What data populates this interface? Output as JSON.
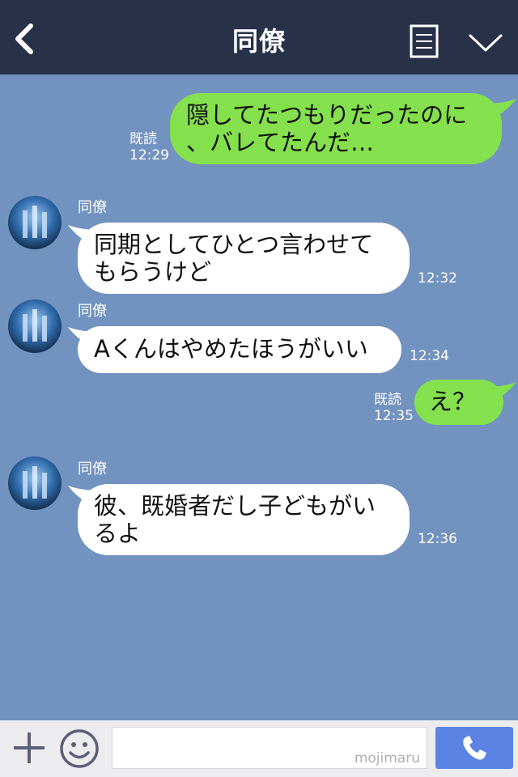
{
  "header": {
    "title": "同僚",
    "back_icon": "chevron-left-icon",
    "memo_icon": "memo-icon",
    "menu_icon": "chevron-down-icon"
  },
  "messages": [
    {
      "side": "me",
      "text": "隠してたつもりだったのに\n、バレてたんだ…",
      "read": "既読",
      "time": "12:29"
    },
    {
      "side": "them",
      "sender": "同僚",
      "text": "同期としてひとつ言わせて\nもらうけど",
      "time": "12:32"
    },
    {
      "side": "them",
      "sender": "同僚",
      "text": "Aくんはやめたほうがいい",
      "time": "12:34"
    },
    {
      "side": "me",
      "text": "え？",
      "read": "既読",
      "time": "12:35"
    },
    {
      "side": "them",
      "sender": "同僚",
      "text": "彼、既婚者だし子どもがい\nるよ",
      "time": "12:36"
    }
  ],
  "footer": {
    "plus_icon": "plus-icon",
    "emoji_icon": "smiley-icon",
    "input_value": "",
    "watermark": "mojimaru",
    "call_icon": "phone-icon"
  },
  "colors": {
    "header_bg": "#283148",
    "chat_bg": "#7292c0",
    "my_bubble": "#84e04c",
    "their_bubble": "#ffffff",
    "call_button": "#5b83e3"
  }
}
